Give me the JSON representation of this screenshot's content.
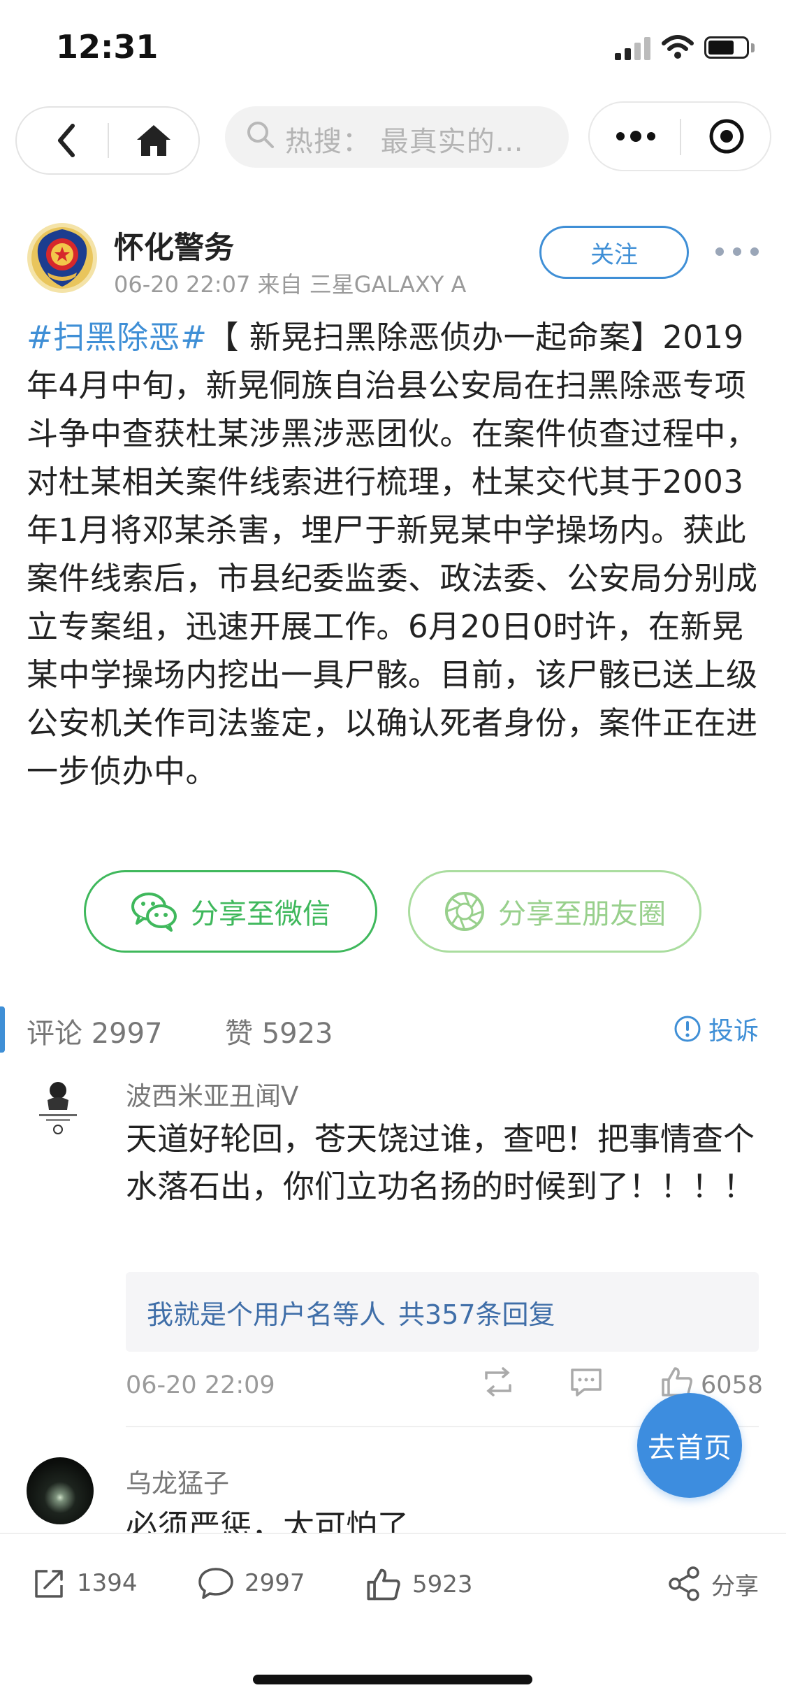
{
  "status_bar": {
    "time": "12:31",
    "battery_level": 0.7
  },
  "nav": {
    "search_placeholder": "热搜：  最真实的…"
  },
  "post": {
    "author": "怀化警务",
    "meta": "06-20 22:07 来自 三星GALAXY A",
    "follow_label": "关注",
    "hashtag": "#扫黑除恶#",
    "body": "【 新晃扫黑除恶侦办一起命案】2019年4月中旬，新晃侗族自治县公安局在扫黑除恶专项斗争中查获杜某涉黑涉恶团伙。在案件侦查过程中，对杜某相关案件线索进行梳理，杜某交代其于2003年1月将邓某杀害，埋尸于新晃某中学操场内。获此案件线索后，市县纪委监委、政法委、公安局分别成立专案组，迅速开展工作。6月20日0时许，在新晃某中学操场内挖出一具尸骸。目前，该尸骸已送上级公安机关作司法鉴定，以确认死者身份，案件正在进一步侦办中。"
  },
  "share": {
    "wechat": "分享至微信",
    "moments": "分享至朋友圈"
  },
  "stats": {
    "comments": "评论 2997",
    "likes": "赞 5923",
    "report": "投诉"
  },
  "comments": [
    {
      "name": "波西米亚丑闻V",
      "text": "天道好轮回，苍天饶过谁，查吧！把事情查个水落石出，你们立功名扬的时候到了！！！！",
      "reply_users": "我就是个用户名等人",
      "reply_count": "共357条回复",
      "time": "06-20 22:09",
      "like_count": "6058"
    },
    {
      "name": "乌龙猛子",
      "text": "必须严惩，太可怕了"
    }
  ],
  "fab": {
    "label": "去首页"
  },
  "toolbar": {
    "repost": "1394",
    "comment": "2997",
    "like": "5923",
    "share": "分享"
  }
}
